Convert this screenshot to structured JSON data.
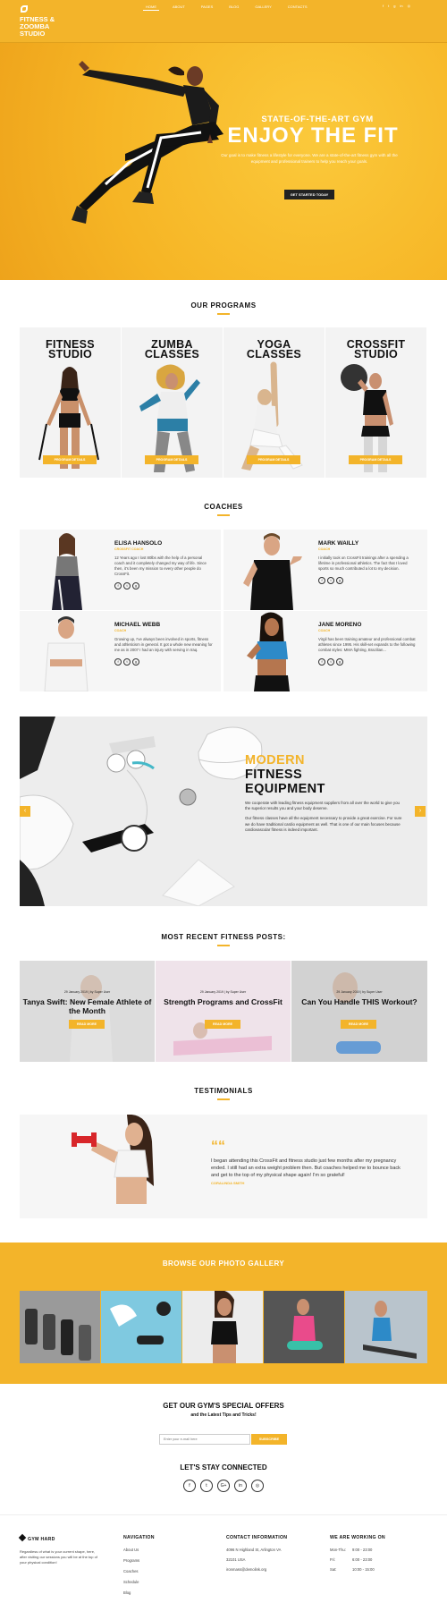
{
  "header": {
    "logo_lines": [
      "FITNESS &",
      "ZOOMBA",
      "STUDIO"
    ],
    "nav": [
      "HOME",
      "ABOUT",
      "PAGES",
      "BLOG",
      "GALLERY",
      "CONTACTS"
    ],
    "social_icons": [
      "facebook-icon",
      "twitter-icon",
      "google-plus-icon",
      "linkedin-icon",
      "dribbble-icon"
    ]
  },
  "hero": {
    "subtitle": "STATE-OF-THE-ART GYM",
    "title": "ENJOY THE FIT",
    "text": "Our goal is to make fitness a lifestyle for everyone. We are a state-of-the-art fitness gym with all the equipment and professional trainers to help you reach your goals.",
    "button": "GET STARTED TODAY"
  },
  "programs": {
    "title": "OUR PROGRAMS",
    "button": "PROGRAM DETAILS",
    "items": [
      {
        "l1": "FITNESS",
        "l2": "STUDIO"
      },
      {
        "l1": "ZUMBA",
        "l2": "CLASSES"
      },
      {
        "l1": "YOGA",
        "l2": "CLASSES"
      },
      {
        "l1": "CROSSFIT",
        "l2": "STUDIO"
      }
    ]
  },
  "coaches": {
    "title": "COACHES",
    "items": [
      {
        "name": "ELISA HANSOLO",
        "role": "CROSSFIT COACH",
        "bio": "12 Years ago I lost 80lbs with the help of a personal coach and it completely changed my way of life. Since then, it's been my mission to every other people do CrossFit."
      },
      {
        "name": "MARK WAILLY",
        "role": "COACH",
        "bio": "I initially took on CrossFit trainings after a spending a lifetime in professional athletics. The fact that I loved sports so much contributed a lot to my decision."
      },
      {
        "name": "MICHAEL WEBB",
        "role": "COACH",
        "bio": "Growing up, I've always been involved in sports, fitness and athleticism in general. It got a whole new meaning for me as in 2007 I had an injury with serving in Iraq."
      },
      {
        "name": "JANE MORENO",
        "role": "COACH",
        "bio": "Virgil has been training amateur and professional combat athletes since 1995. His skill-set expands to the following combat styles: MMA fighting, Brazilian..."
      }
    ]
  },
  "equipment": {
    "title_l1": "MODERN",
    "title_l2": "FITNESS",
    "title_l3": "EQUIPMENT",
    "p1": "We cooperate with leading fitness equipment suppliers from all over the world to give you the superior results you and your body deserve.",
    "p2": "Our fitness classes have all the equipment necessary to provide a great exercise. For sure we do have traditional cardio equipment as well. That is one of our main focuses because cardiovascular fitness is indeed important."
  },
  "posts": {
    "title": "MOST RECENT FITNESS POSTS:",
    "button": "READ MORE",
    "items": [
      {
        "meta": "29 January 2019  |  by Super User",
        "title": "Tanya Swift: New Female Athlete of the Month"
      },
      {
        "meta": "29 January 2019  |  by Super User",
        "title": "Strength Programs and CrossFit"
      },
      {
        "meta": "29 January 2019  |  by Super User",
        "title": "Can You Handle THIS Workout?"
      }
    ]
  },
  "testimonials": {
    "title": "TESTIMONIALS",
    "quote_mark": "““",
    "text": "I began attending this CrossFit and fitness studio just few months after my pregnancy ended. I still had an extra weight problem then. But coaches helped me to bounce back and get to the top of my physical shape again! I'm so grateful!",
    "author": "CORALINDA SMITH"
  },
  "gallery": {
    "title": "BROWSE OUR PHOTO GALLERY"
  },
  "offers": {
    "title": "GET OUR GYM'S SPECIAL OFFERS",
    "subtitle": "and the Latest Tips and Tricks!",
    "email_placeholder": "Enter your e-mail here",
    "button": "SUBSCRIBE"
  },
  "connect": {
    "title": "LET'S STAY CONNECTED",
    "icons": [
      "f",
      "t",
      "G+",
      "in",
      "◎"
    ]
  },
  "footer": {
    "brand": "GYM HARD",
    "about": "Regardless of what is your current shape, here, after visiting our sessions you will be at the top of your physical condition!",
    "nav_title": "NAVIGATION",
    "nav": [
      "About Us",
      "Programs",
      "Coaches",
      "Schedule",
      "Blog"
    ],
    "contact_title": "CONTACT INFORMATION",
    "contact": [
      "4096 N Highland St, Arlington VA",
      "32101 USA",
      "ironmass@demolink.org"
    ],
    "hours_title": "WE ARE WORKING ON",
    "hours": [
      {
        "d": "Mon-Thu:",
        "t": "9:00 - 23:00"
      },
      {
        "d": "Fri:",
        "t": "6:00 - 23:00"
      },
      {
        "d": "Sat:",
        "t": "10:00 - 15:00"
      }
    ]
  },
  "colors": {
    "accent": "#f3b42a",
    "dark": "#222222"
  }
}
